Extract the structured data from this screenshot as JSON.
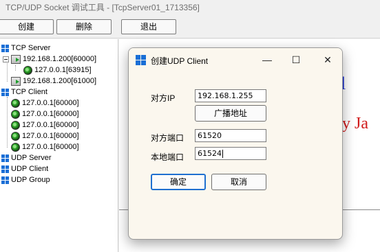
{
  "window": {
    "title": "TCP/UDP Socket 调试工具 - [TcpServer01_1713356]"
  },
  "toolbar": {
    "create": "创建",
    "delete": "删除",
    "exit": "退出"
  },
  "tree": {
    "tcp_server": "TCP Server",
    "server1": "192.168.1.200[60000]",
    "server1_client": "127.0.0.1[63915]",
    "server2": "192.168.1.200[61000]",
    "tcp_client": "TCP Client",
    "clients": [
      "127.0.0.1[60000]",
      "127.0.0.1[60000]",
      "127.0.0.1[60000]",
      "127.0.0.1[60000]",
      "127.0.0.1[60000]"
    ],
    "udp_server": "UDP Server",
    "udp_client": "UDP Client",
    "udp_group": "UDP Group"
  },
  "background": {
    "text1": "l",
    "text2": "y Ja"
  },
  "dialog": {
    "title": "创建UDP Client",
    "minimize": "—",
    "maximize": "☐",
    "close": "✕",
    "peer_ip_label": "对方IP",
    "peer_ip_value": "192.168.1.255",
    "broadcast_button": "广播地址",
    "peer_port_label": "对方端口",
    "peer_port_value": "61520",
    "local_port_label": "本地端口",
    "local_port_value": "61524",
    "ok_button": "确定",
    "cancel_button": "取消"
  },
  "colors": {
    "accent": "#1e6fd0",
    "icon_blue": "#1a6fd6",
    "bg_text1": "#1a2fd0",
    "bg_text2": "#d01a1a"
  }
}
